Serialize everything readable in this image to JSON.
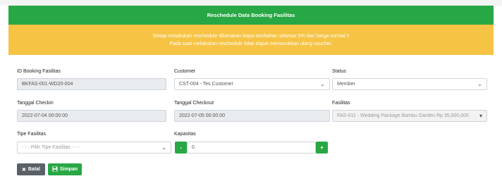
{
  "header": {
    "title": "Reschedule Data Booking Fasilitas"
  },
  "warning": {
    "line1": "Setiap melakukan reschedule dikenakan biaya tambahan sebesar 5% dari harga normal !!",
    "line2": "Pada saat melakukan reschedule tidak dapat memasukkan ulang voucher."
  },
  "form": {
    "id_booking": {
      "label": "ID Booking Fasilitas",
      "value": "BKFAS-001-WD20-004"
    },
    "customer": {
      "label": "Customer",
      "value": "CST-004 - Tes Customer"
    },
    "status": {
      "label": "Status",
      "value": "Member"
    },
    "checkin": {
      "label": "Tanggal Checkin",
      "value": "2022-07-04 00:00:00"
    },
    "checkout": {
      "label": "Tanggal Checkout",
      "value": "2022-07-05 00:00:00"
    },
    "fasilitas": {
      "label": "Fasilitas",
      "value": "FAS-011 - Wedding Package Bambu Garden Rp 35,000,000"
    },
    "tipe": {
      "label": "Tipe Fasilitas",
      "placeholder": "- - - Pilih Tipe Fasilitas - - -"
    },
    "kapasitas": {
      "label": "Kapasitas",
      "value": "0",
      "minus": "-",
      "plus": "+"
    }
  },
  "actions": {
    "cancel_label": "Batal",
    "save_label": "Simpan"
  },
  "icons": {
    "cancel": "times-icon",
    "save": "save-icon",
    "dropdown": "chevron-down-icon"
  },
  "colors": {
    "header": "#28a745",
    "warning": "#f6c344",
    "cancel": "#5a6268",
    "save": "#28a745"
  }
}
